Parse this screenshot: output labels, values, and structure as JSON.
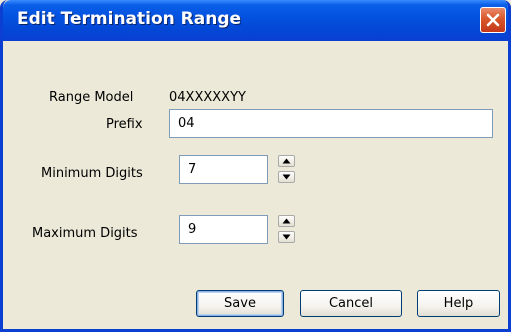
{
  "dialog": {
    "title": "Edit Termination Range"
  },
  "form": {
    "range_model_label": "Range Model",
    "range_model_value": "04XXXXXYY",
    "prefix_label": "Prefix",
    "prefix_value": "04",
    "min_digits_label": "Minimum Digits",
    "min_digits_value": "7",
    "max_digits_label": "Maximum Digits",
    "max_digits_value": "9"
  },
  "buttons": {
    "save": "Save",
    "cancel": "Cancel",
    "help": "Help"
  },
  "icons": {
    "close": "close-icon",
    "spin_up": "arrow-up-icon",
    "spin_down": "arrow-down-icon"
  },
  "colors": {
    "titlebar": "#0a5fe8",
    "close_button": "#d9572c",
    "dialog_background": "#ece9d8",
    "field_border": "#7f9db9"
  }
}
